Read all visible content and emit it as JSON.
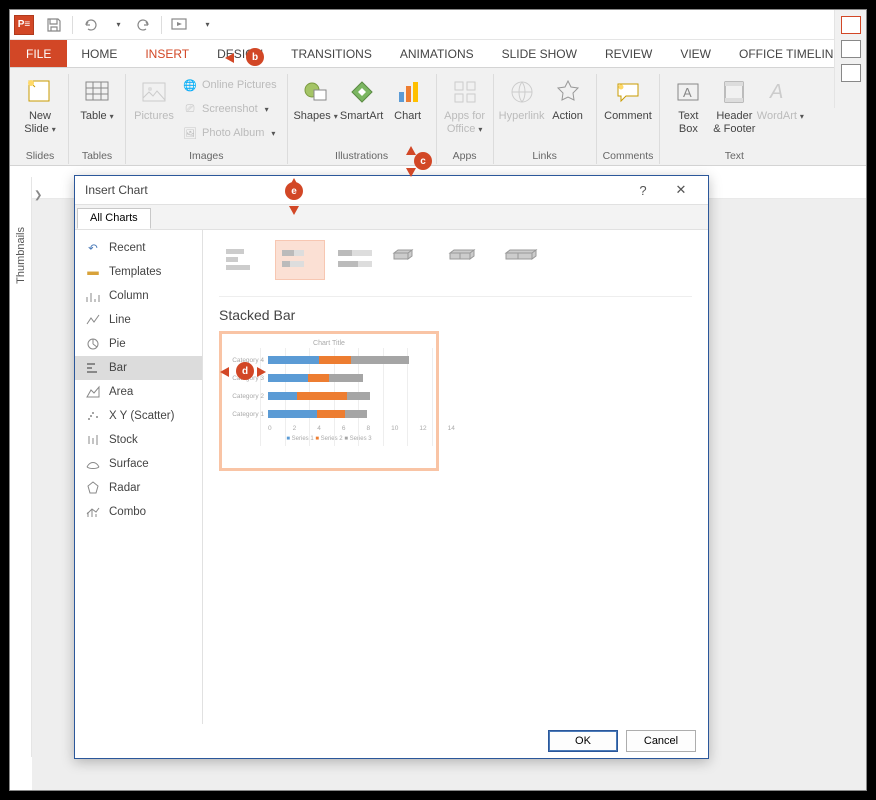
{
  "qat": {
    "save_title": "Save",
    "undo_title": "Undo",
    "redo_title": "Redo",
    "start_title": "Start From Beginning"
  },
  "tabs": {
    "file": "FILE",
    "home": "HOME",
    "insert": "INSERT",
    "design": "DESIGN",
    "transitions": "TRANSITIONS",
    "animations": "ANIMATIONS",
    "slideshow": "SLIDE SHOW",
    "review": "REVIEW",
    "view": "VIEW",
    "timeline": "OFFICE TIMELINE+"
  },
  "ribbon": {
    "slides": {
      "label": "Slides",
      "new_slide": "New\nSlide"
    },
    "tables": {
      "label": "Tables",
      "table": "Table"
    },
    "images": {
      "label": "Images",
      "pictures": "Pictures",
      "online_pictures": "Online Pictures",
      "screenshot": "Screenshot",
      "photo_album": "Photo Album"
    },
    "illustrations": {
      "label": "Illustrations",
      "shapes": "Shapes",
      "smartart": "SmartArt",
      "chart": "Chart"
    },
    "apps": {
      "label": "Apps",
      "apps_for_office": "Apps for\nOffice"
    },
    "links": {
      "label": "Links",
      "hyperlink": "Hyperlink",
      "action": "Action"
    },
    "comments": {
      "label": "Comments",
      "comment": "Comment"
    },
    "text": {
      "label": "Text",
      "text_box": "Text\nBox",
      "header_footer": "Header\n& Footer",
      "wordart": "WordArt"
    }
  },
  "thumb_strip": {
    "label": "Thumbnails"
  },
  "dialog": {
    "title": "Insert Chart",
    "tab": "All Charts",
    "help": "?",
    "close": "✕",
    "side": [
      "Recent",
      "Templates",
      "Column",
      "Line",
      "Pie",
      "Bar",
      "Area",
      "X Y (Scatter)",
      "Stock",
      "Surface",
      "Radar",
      "Combo"
    ],
    "side_selected_index": 5,
    "subtype_selected_index": 1,
    "subtype_name": "Stacked Bar",
    "ok": "OK",
    "cancel": "Cancel"
  },
  "chart_data": {
    "type": "bar",
    "orientation": "horizontal",
    "stacked": true,
    "title": "Chart Title",
    "xlabel": "",
    "ylabel": "",
    "xlim": [
      0,
      14
    ],
    "xticks": [
      0,
      2,
      4,
      6,
      8,
      10,
      12,
      14
    ],
    "categories": [
      "Category 4",
      "Category 3",
      "Category 2",
      "Category 1"
    ],
    "series": [
      {
        "name": "Series 1",
        "color": "#5b9bd5",
        "values": [
          4.5,
          3.5,
          2.5,
          4.3
        ]
      },
      {
        "name": "Series 2",
        "color": "#ed7d31",
        "values": [
          2.8,
          1.8,
          4.4,
          2.4
        ]
      },
      {
        "name": "Series 3",
        "color": "#a5a5a5",
        "values": [
          5.0,
          3.0,
          2.0,
          2.0
        ]
      }
    ],
    "legend_position": "bottom"
  },
  "callouts": {
    "b": "b",
    "c": "c",
    "d": "d",
    "e": "e"
  }
}
